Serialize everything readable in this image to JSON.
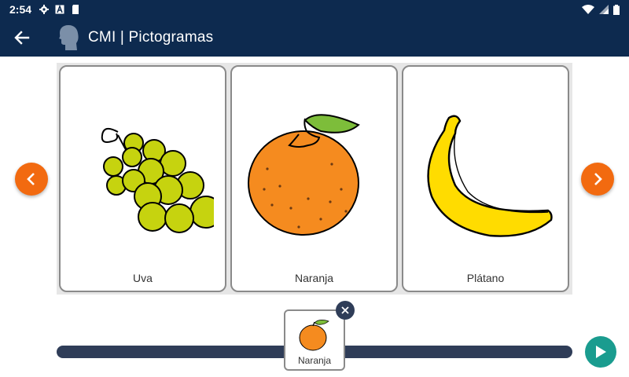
{
  "status_bar": {
    "time": "2:54",
    "left_icons": [
      "settings-icon",
      "keyboard-a-icon",
      "sd-card-icon"
    ],
    "right_icons": [
      "wifi-icon",
      "signal-icon",
      "battery-icon"
    ]
  },
  "app_bar": {
    "back_icon": "arrow-back-icon",
    "logo_icon": "head-silhouette-icon",
    "title": "CMI | Pictogramas"
  },
  "carousel": {
    "cards": [
      {
        "label": "Uva",
        "icon": "grapes-icon"
      },
      {
        "label": "Naranja",
        "icon": "orange-icon"
      },
      {
        "label": "Plátano",
        "icon": "banana-icon"
      }
    ],
    "prev_icon": "chevron-left-icon",
    "next_icon": "chevron-right-icon"
  },
  "sentence": {
    "items": [
      {
        "label": "Naranja",
        "icon": "orange-icon"
      }
    ],
    "remove_icon": "close-icon",
    "play_icon": "play-icon"
  },
  "colors": {
    "bar": "#0d2a4f",
    "accent": "#f26a10",
    "track": "#2f3d58",
    "play": "#1a9c8f"
  }
}
